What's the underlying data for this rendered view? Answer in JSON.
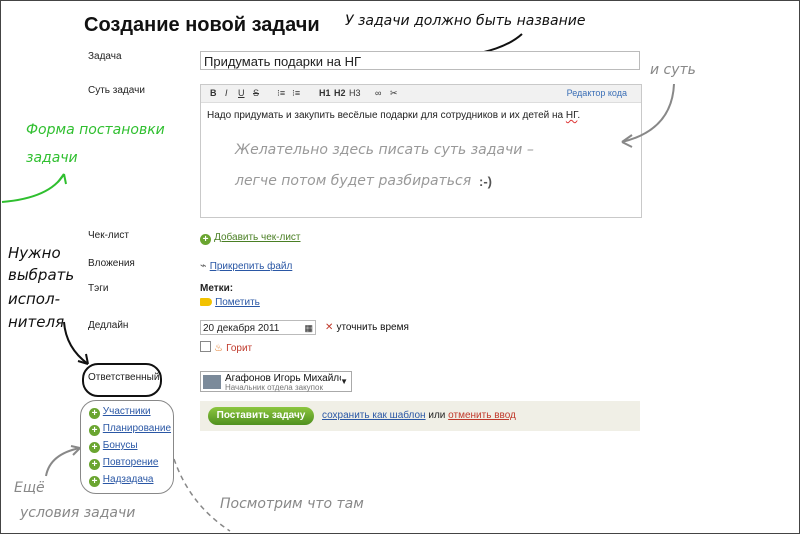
{
  "page": {
    "title": "Создание новой задачи"
  },
  "form": {
    "task_label": "Задача",
    "task_value": "Придумать подарки на НГ",
    "essence_label": "Суть задачи",
    "editor": {
      "toolbar": {
        "bold": "B",
        "italic": "I",
        "underline": "U",
        "strike": "S",
        "h1": "H1",
        "h2": "H2",
        "h3": "H3",
        "code_link": "Редактор кода"
      },
      "text_prefix": "Надо придумать и закупить весёлые подарки для сотрудников и их детей на ",
      "text_underlined": "НГ",
      "text_suffix": "."
    },
    "checklist_label": "Чек-лист",
    "add_checklist": "Добавить чек-лист",
    "attachments_label": "Вложения",
    "attach_file": "Прикрепить файл",
    "tags_label": "Тэги",
    "marks_title": "Метки:",
    "mark_link": "Пометить",
    "deadline_label": "Дедлайн",
    "deadline_value": "20 декабря 2011",
    "clarify_time": "уточнить время",
    "urgent_label": "Горит",
    "responsible_label": "Ответственный",
    "assignee": {
      "name": "Агафонов Игорь Михайлович",
      "position": "Начальник отдела закупок"
    },
    "submit": "Поставить задачу",
    "save_template": "сохранить как шаблон",
    "or": "или",
    "cancel": "отменить ввод"
  },
  "sidebar": {
    "items": [
      {
        "label": "Участники"
      },
      {
        "label": "Планирование"
      },
      {
        "label": "Бонусы"
      },
      {
        "label": "Повторение"
      },
      {
        "label": "Надзадача"
      }
    ]
  },
  "annotations": {
    "task_name": "У задачи должно быть название",
    "essence": "и суть",
    "form_line1": "Форма постановки",
    "form_line2": "задачи",
    "editor_note1": "Желательно здесь писать суть задачи –",
    "editor_note2": "легче потом будет разбираться",
    "smile": ":-)",
    "executor1": "Нужно",
    "executor2": "выбрать",
    "executor3": "испол-",
    "executor4": "нителя",
    "more1": "Ещё",
    "more2": "условия задачи",
    "look": "Посмотрим что там"
  },
  "colors": {
    "accent_green": "#4e8f1e",
    "link_blue": "#2a57a5",
    "cancel_red": "#c0392b",
    "annotation_green": "#2fbf2f"
  }
}
